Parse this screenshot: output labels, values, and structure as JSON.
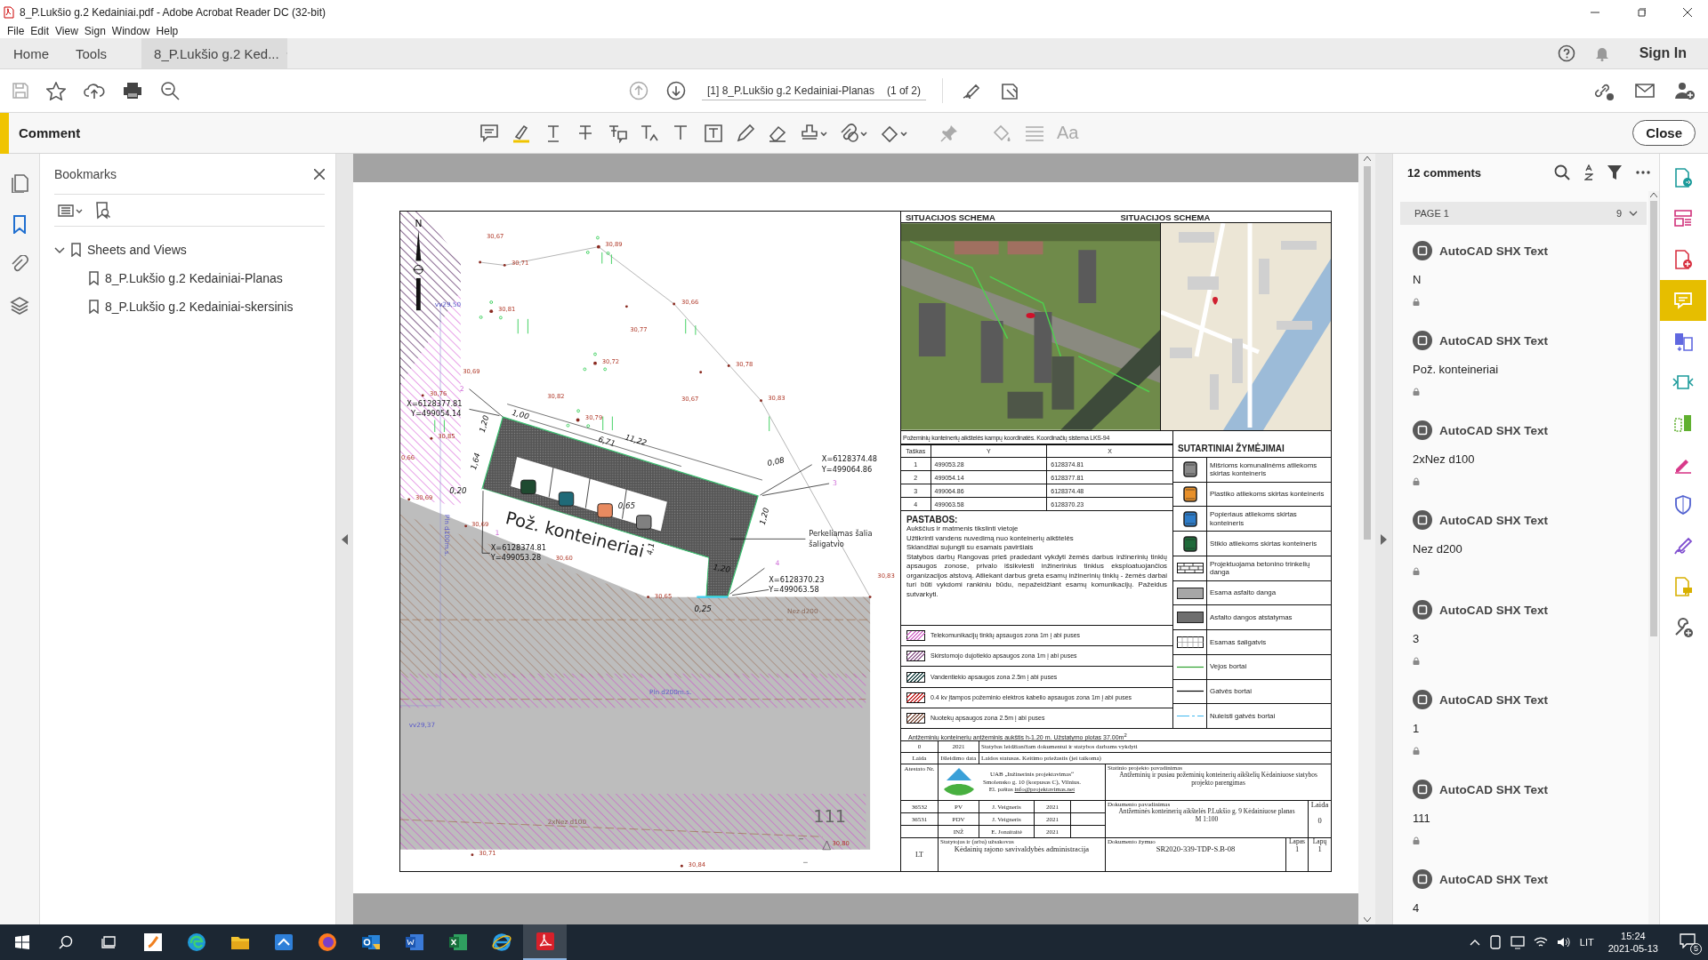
{
  "window": {
    "title": "8_P.Lukšio g.2 Kedainiai.pdf - Adobe Acrobat Reader DC (32-bit)"
  },
  "menu": [
    "File",
    "Edit",
    "View",
    "Sign",
    "Window",
    "Help"
  ],
  "tabs": [
    {
      "label": "Home",
      "selected": false,
      "closable": false
    },
    {
      "label": "Tools",
      "selected": false,
      "closable": false
    },
    {
      "label": "8_P.Lukšio g.2 Ked...",
      "selected": true,
      "closable": true
    }
  ],
  "account": {
    "sign_in": "Sign In"
  },
  "toolbar": {
    "page_label": "[1] 8_P.Lukšio g.2 Kedainiai-Planas",
    "page_count": "(1 of 2)"
  },
  "comment_bar": {
    "title": "Comment",
    "font_tool": "Aa",
    "close": "Close"
  },
  "left_rail": [
    {
      "kind": "pages",
      "selected": false
    },
    {
      "kind": "bookmarks",
      "selected": true
    },
    {
      "kind": "attachments",
      "selected": false
    },
    {
      "kind": "layers",
      "selected": false
    }
  ],
  "bookmarks": {
    "title": "Bookmarks",
    "items": [
      {
        "label": "Sheets and Views",
        "expanded": true,
        "children": [
          {
            "label": "8_P.Lukšio g.2 Kedainiai-Planas"
          },
          {
            "label": "8_P.Lukšio g.2 Kedainiai-skersinis"
          }
        ]
      }
    ]
  },
  "drawing": {
    "labels": [
      {
        "text": "N",
        "kind": "north"
      },
      {
        "text": "30,67",
        "kind": "elevation"
      },
      {
        "text": "30,89",
        "kind": "elevation"
      },
      {
        "text": "30,71",
        "kind": "elevation"
      },
      {
        "text": "vv29,50",
        "kind": "note"
      },
      {
        "text": "30,81",
        "kind": "elevation"
      },
      {
        "text": "30,66",
        "kind": "elevation"
      },
      {
        "text": "30,77",
        "kind": "elevation"
      },
      {
        "text": "30,72",
        "kind": "elevation"
      },
      {
        "text": "30,78",
        "kind": "elevation"
      },
      {
        "text": "30,69",
        "kind": "elevation"
      },
      {
        "text": "2",
        "kind": "point"
      },
      {
        "text": "30,76",
        "kind": "elevation"
      },
      {
        "text": "30,82",
        "kind": "elevation"
      },
      {
        "text": "30,67",
        "kind": "elevation"
      },
      {
        "text": "30,83",
        "kind": "elevation"
      },
      {
        "text": "X=6128377.81",
        "kind": "coordinate"
      },
      {
        "text": "Y=499054.14",
        "kind": "coordinate"
      },
      {
        "text": "1,00",
        "kind": "dimension"
      },
      {
        "text": "30,79",
        "kind": "elevation"
      },
      {
        "text": "1,20",
        "kind": "dimension"
      },
      {
        "text": "11,22",
        "kind": "dimension"
      },
      {
        "text": "6,71",
        "kind": "dimension"
      },
      {
        "text": "30,85",
        "kind": "elevation"
      },
      {
        "text": "0,66",
        "kind": "elevation"
      },
      {
        "text": "1,64",
        "kind": "dimension"
      },
      {
        "text": "0,08",
        "kind": "dimension"
      },
      {
        "text": "X=6128374.48",
        "kind": "coordinate"
      },
      {
        "text": "Y=499064.86",
        "kind": "coordinate"
      },
      {
        "text": "3",
        "kind": "point"
      },
      {
        "text": "0,20",
        "kind": "dimension"
      },
      {
        "text": "30,69",
        "kind": "elevation"
      },
      {
        "text": "0,65",
        "kind": "dimension"
      },
      {
        "text": "1,20",
        "kind": "dimension"
      },
      {
        "text": "Pož. konteineriai",
        "kind": "title"
      },
      {
        "text": "1",
        "kind": "point"
      },
      {
        "text": "30,69",
        "kind": "elevation"
      },
      {
        "text": "Pln d100m.s.",
        "kind": "note"
      },
      {
        "text": "Perkeliamas šalia",
        "kind": "callout"
      },
      {
        "text": "šaligatvio",
        "kind": "callout"
      },
      {
        "text": "X=6128374.81",
        "kind": "coordinate"
      },
      {
        "text": "Y=499053.28",
        "kind": "coordinate"
      },
      {
        "text": "30,60",
        "kind": "elevation"
      },
      {
        "text": "4,1",
        "kind": "dimension"
      },
      {
        "text": "4",
        "kind": "point"
      },
      {
        "text": "1,20",
        "kind": "dimension"
      },
      {
        "text": "30,83",
        "kind": "elevation"
      },
      {
        "text": "X=6128370.23",
        "kind": "coordinate"
      },
      {
        "text": "Y=499063.58",
        "kind": "coordinate"
      },
      {
        "text": "30,65",
        "kind": "elevation"
      },
      {
        "text": "0,25",
        "kind": "dimension"
      },
      {
        "text": "Nez d200",
        "kind": "pipe"
      },
      {
        "text": "Pln d200m.s.",
        "kind": "note"
      },
      {
        "text": "vv29,37",
        "kind": "note"
      },
      {
        "text": "111",
        "kind": "number"
      },
      {
        "text": "2xNez d100",
        "kind": "pipe"
      },
      {
        "text": "30,80",
        "kind": "elevation"
      },
      {
        "text": "30,71",
        "kind": "elevation"
      },
      {
        "text": "30,84",
        "kind": "elevation"
      }
    ]
  },
  "situation": {
    "titles": [
      "SITUACIJOS SCHEMA",
      "SITUACIJOS SCHEMA"
    ],
    "maps": [
      {
        "kind": "picture"
      },
      {
        "kind": "picture"
      }
    ]
  },
  "coordinates": {
    "caption": "Požeminių konteinerių aikštelės kampų koordinatės. Koordinačių sistema LKS-94",
    "columns": [
      "Taškas",
      "Y",
      "X"
    ],
    "rows": [
      [
        "1",
        "499053.28",
        "6128374.81"
      ],
      [
        "2",
        "499054.14",
        "6128377.81"
      ],
      [
        "3",
        "499064.86",
        "6128374.48"
      ],
      [
        "4",
        "499063.58",
        "6128370.23"
      ]
    ]
  },
  "notes": {
    "title": "PASTABOS:",
    "lines": [
      "Aukščius ir matmenis tikslinti vietoje",
      "Užtikrinti vandens nuvedimą nuo konteinerių aikštelės",
      "Sklandžiai sujungti su esamais paviršiais",
      "Statybos darbų Rangovas prieš pradedant vykdyti žemės darbus inžinerinių tinklų apsaugos zonose, privalo išsikviesti inžinerinius tinklus eksploatuojančios organizacijos atstovą. Atliekant darbus greta esamų inžinerinių tinklų - žemės darbai turi būti vykdomi rankiniu būdu, nepažeidžiant esamų komunikacijų. Pažeidus sutvarkyti."
    ]
  },
  "zones": [
    {
      "label": "Telekomunikacijų tinklų apsaugos zona 1m į abi puses",
      "color": "#d878d0"
    },
    {
      "label": "Skirstomojo dujotiekio apsaugos zona 1m į abi puses",
      "color": "#9a6a9a"
    },
    {
      "label": "Vandentiekio apsaugos zona 2.5m į abi puses",
      "color": "#2a5050"
    },
    {
      "label": "0.4 kv įtampos požeminio elektros kabelio apsaugos zona 1m į abi puses",
      "color": "#c83030"
    },
    {
      "label": "Nuotekų apsaugos zona 2.5m į abi puses",
      "color": "#8a6050"
    }
  ],
  "legend": {
    "title": "SUTARTINIAI ŽYMĖJIMAI",
    "items": [
      {
        "kind": "container",
        "color": "#8a8a8a",
        "label": "Mišrioms komunalinėms atliekoms skirtas konteineris"
      },
      {
        "kind": "container",
        "color": "#e8902a",
        "label": "Plastiko atliekoms skirtas konteineris"
      },
      {
        "kind": "container",
        "color": "#2e7cc8",
        "label": "Popieriaus atliekoms skirtas konteineris"
      },
      {
        "kind": "container",
        "color": "#1f6a3a",
        "label": "Stiklo atliekoms skirtas konteineris"
      },
      {
        "kind": "paving",
        "label": "Projektuojama betonino trinkelių danga"
      },
      {
        "kind": "fill",
        "color": "#a6a6a6",
        "label": "Esama asfalto danga"
      },
      {
        "kind": "fill",
        "color": "#6e6e6e",
        "label": "Asfalto dangos atstatymas"
      },
      {
        "kind": "sidewalk",
        "label": "Esamas šaligatvis"
      },
      {
        "kind": "line",
        "color": "#2ca02c",
        "label": "Vejos bortai"
      },
      {
        "kind": "line",
        "color": "#000000",
        "label": "Gatvės bortai"
      },
      {
        "kind": "dashed",
        "color": "#40b8f0",
        "label": "Nuleisti gatvės bortai"
      }
    ]
  },
  "summary": "Antžeminių konteinerių antžeminis aukštis h-1.20 m. Užstatymo plotas 37.00m$^{2}$",
  "title_block": {
    "revision": [
      "0",
      "2021",
      "Statybas leidžiančiam dokumentui ir statybos darbams vykdyti"
    ],
    "revision_header": [
      "Laida",
      "Išleidimo data",
      "Laidos statusas. Keitimo priežastis (jei taikoma)"
    ],
    "certificate_label": "Atestato Nr.",
    "company": [
      "UAB „Inžinerinis projektavimas“",
      "Smolensko g. 10 (korpusas C), Vilnius."
    ],
    "email_label": "El. paštas",
    "email": "info@projektavimas.net",
    "project_label": "Statinio projekto pavadinimas",
    "project": "Antžeminių ir pusiau požeminių konteinerių aikštelių Kėdainiuose statybos projekto parengimas",
    "signatures": [
      {
        "number": "36532",
        "role": "PV",
        "name": "J. Veigneris",
        "year": "2021"
      },
      {
        "number": "36531",
        "role": "PDV",
        "name": "J. Veigneris",
        "year": "2021"
      },
      {
        "role": "INŽ",
        "name": "E. Jonaitaitė",
        "year": "2021"
      }
    ],
    "document_label": "Dokumento pavadinimas",
    "document": "Antžeminės konteinerių aikštelės P.Lukšio g. 9 Kėdainiuose planas",
    "scale": "M 1:100",
    "edition_label": "Laida",
    "edition": "0",
    "country": "LT",
    "client_label": "Statytojas ir (arba) užsakovas",
    "client": "Kėdainių rajono savivaldybės administracija",
    "code_label": "Dokumento žymuo",
    "code": "SR2020-339-TDP-S.B-08",
    "sheet_label": "Lapas",
    "sheet": "1",
    "sheets_label": "Lapų",
    "sheets": "1"
  },
  "comments": {
    "count": "12 comments",
    "page": {
      "label": "PAGE 1",
      "count": "9"
    },
    "items": [
      {
        "author": "AutoCAD SHX Text",
        "text": "N",
        "locked": true
      },
      {
        "author": "AutoCAD SHX Text",
        "text": "Pož. konteineriai",
        "locked": true
      },
      {
        "author": "AutoCAD SHX Text",
        "text": "2xNez d100",
        "locked": true
      },
      {
        "author": "AutoCAD SHX Text",
        "text": "Nez d200",
        "locked": true
      },
      {
        "author": "AutoCAD SHX Text",
        "text": "3",
        "locked": true
      },
      {
        "author": "AutoCAD SHX Text",
        "text": "1",
        "locked": true
      },
      {
        "author": "AutoCAD SHX Text",
        "text": "111",
        "locked": true
      },
      {
        "author": "AutoCAD SHX Text",
        "text": "4"
      }
    ]
  },
  "right_rail": [
    {
      "kind": "export",
      "selected": false
    },
    {
      "kind": "form",
      "selected": false
    },
    {
      "kind": "create",
      "selected": false
    },
    {
      "kind": "comment",
      "selected": true
    },
    {
      "kind": "combine",
      "selected": false
    },
    {
      "kind": "compress",
      "selected": false
    },
    {
      "kind": "organize",
      "selected": false
    },
    {
      "kind": "fill",
      "selected": false
    },
    {
      "kind": "protect",
      "selected": false
    },
    {
      "kind": "sign",
      "selected": false
    },
    {
      "kind": "review",
      "selected": false
    },
    {
      "kind": "tools",
      "selected": false
    }
  ],
  "taskbar": {
    "apps": [
      {
        "kind": "paint",
        "active": false
      },
      {
        "kind": "edge",
        "active": false
      },
      {
        "kind": "explorer",
        "active": false
      },
      {
        "kind": "installer",
        "active": false
      },
      {
        "kind": "firefox",
        "active": false
      },
      {
        "kind": "outlook",
        "active": false
      },
      {
        "kind": "word",
        "active": false
      },
      {
        "kind": "excel",
        "active": false
      },
      {
        "kind": "ie",
        "active": false
      },
      {
        "kind": "acrobat",
        "active": true
      }
    ],
    "language": "LIT",
    "time": "15:24",
    "date": "2021-05-13",
    "notifications": "5"
  }
}
